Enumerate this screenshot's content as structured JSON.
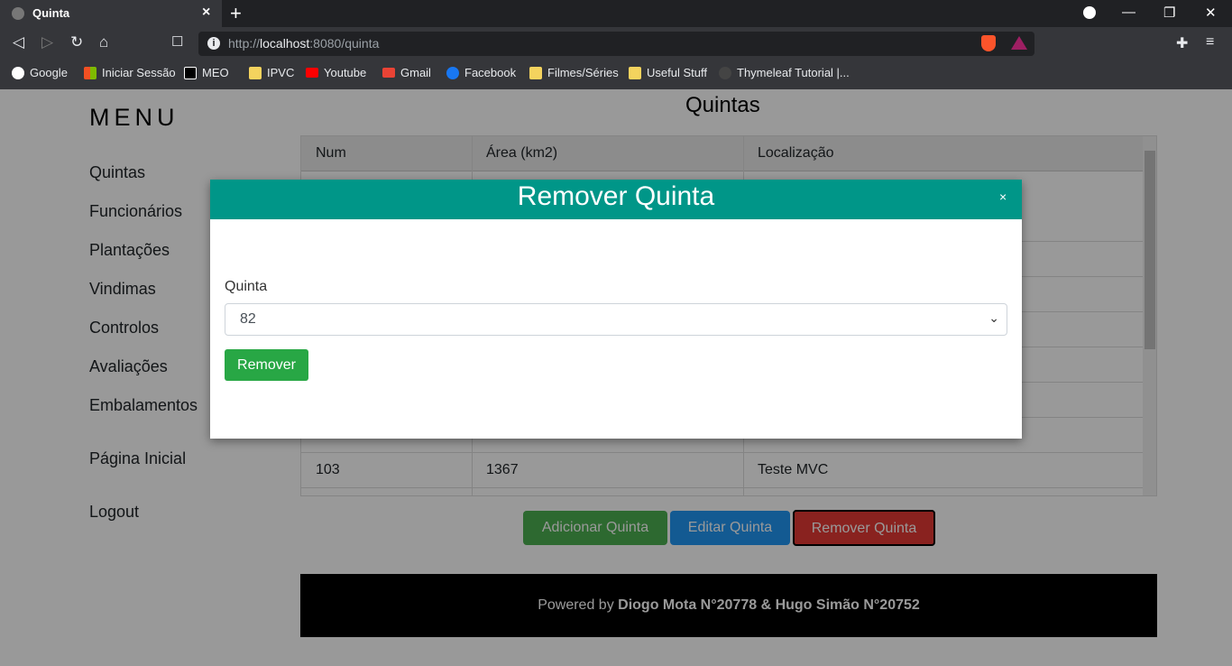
{
  "browser": {
    "tab_title": "Quinta",
    "tab_close": "×",
    "new_tab": "+",
    "url_prefix": "http://",
    "url_host": "localhost",
    "url_rest": ":8080/quinta",
    "window_controls": {
      "minimize": "—",
      "restore": "❐",
      "close": "✕"
    },
    "nav": {
      "back": "◁",
      "forward": "▷",
      "reload": "↻",
      "home": "⌂",
      "bookmark": "☐"
    },
    "extensions": {
      "puzzle": "✚",
      "menu": "≡"
    },
    "bookmarks": [
      "Google",
      "Iniciar Sessão",
      "MEO",
      "IPVC",
      "Youtube",
      "Gmail",
      "Facebook",
      "Filmes/Séries",
      "Useful Stuff",
      "Thymeleaf Tutorial |..."
    ]
  },
  "sidebar": {
    "title": "MENU",
    "items": [
      "Quintas",
      "Funcionários",
      "Plantações",
      "Vindimas",
      "Controlos",
      "Avaliações",
      "Embalamentos",
      "Página Inicial",
      "Logout"
    ]
  },
  "main": {
    "title": "Quintas",
    "table": {
      "headers": [
        "Num",
        "Área (km2)",
        "Localização"
      ],
      "last_row": [
        "103",
        "1367",
        "Teste MVC"
      ]
    },
    "buttons": {
      "add": "Adicionar Quinta",
      "edit": "Editar Quinta",
      "remove": "Remover Quinta"
    }
  },
  "footer": {
    "prefix": "Powered by ",
    "authors": "Diogo Mota N°20778 & Hugo Simão N°20752"
  },
  "modal": {
    "title": "Remover Quinta",
    "close": "×",
    "field_label": "Quinta",
    "selected_value": "82",
    "caret": "⌄",
    "submit": "Remover"
  },
  "colors": {
    "teal": "#009688",
    "green": "#28a745",
    "blue": "#2196f3",
    "red": "#dc3545"
  }
}
